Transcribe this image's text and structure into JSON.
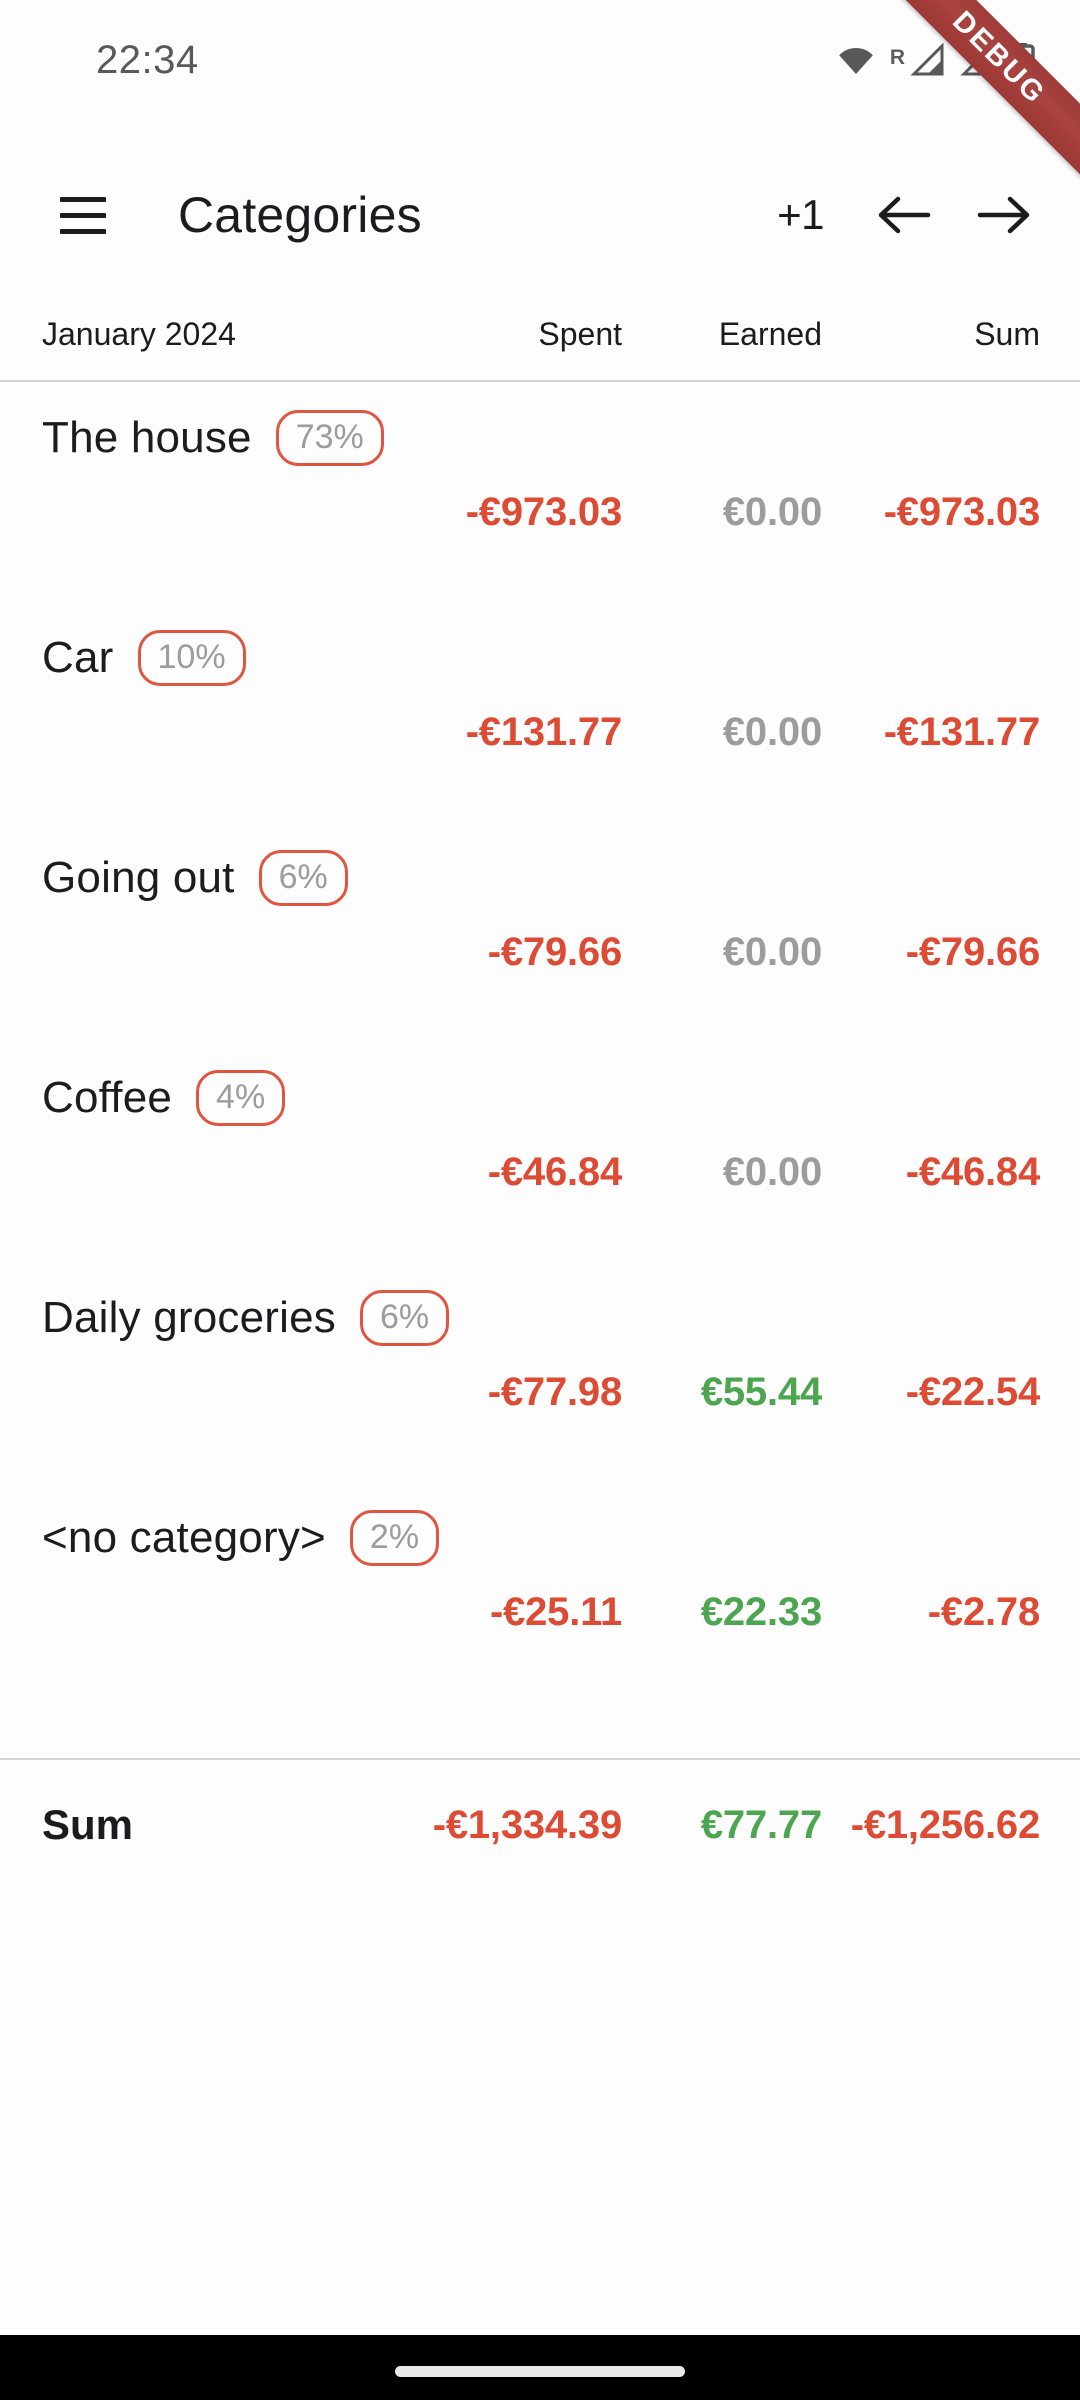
{
  "status_bar": {
    "clock": "22:34",
    "roaming_label": "R",
    "icons": [
      "wifi-icon",
      "roaming-label",
      "signal-1-icon",
      "signal-2-icon",
      "battery-icon"
    ]
  },
  "debug_banner": {
    "label": "DEBUG",
    "color": "#A94440",
    "text_color": "#FFFFFF"
  },
  "app_bar": {
    "menu_icon": "hamburger-menu-icon",
    "title": "Categories",
    "add_label": "+1",
    "prev_icon": "arrow-left-icon",
    "next_icon": "arrow-right-icon"
  },
  "table": {
    "headers": {
      "period": "January 2024",
      "spent": "Spent",
      "earned": "Earned",
      "sum": "Sum"
    },
    "rows": [
      {
        "name": "The house",
        "percent": "73%",
        "spent": "-€973.03",
        "earned": "€0.00",
        "sum": "-€973.03"
      },
      {
        "name": "Car",
        "percent": "10%",
        "spent": "-€131.77",
        "earned": "€0.00",
        "sum": "-€131.77"
      },
      {
        "name": "Going out",
        "percent": "6%",
        "spent": "-€79.66",
        "earned": "€0.00",
        "sum": "-€79.66"
      },
      {
        "name": "Coffee",
        "percent": "4%",
        "spent": "-€46.84",
        "earned": "€0.00",
        "sum": "-€46.84"
      },
      {
        "name": "Daily groceries",
        "percent": "6%",
        "spent": "-€77.98",
        "earned": "€55.44",
        "sum": "-€22.54"
      },
      {
        "name": "<no category>",
        "percent": "2%",
        "spent": "-€25.11",
        "earned": "€22.33",
        "sum": "-€2.78"
      }
    ],
    "footer": {
      "label": "Sum",
      "spent": "-€1,334.39",
      "earned": "€77.77",
      "sum": "-€1,256.62"
    }
  },
  "colors": {
    "negative": "#DD4B35",
    "positive": "#4CA650",
    "muted": "#9C9C9E",
    "badge_border": "#DF5540",
    "background": "#FDFDFE",
    "divider": "#D4D4D6"
  },
  "nav_bar": {
    "handle": "gesture-home-pill"
  }
}
